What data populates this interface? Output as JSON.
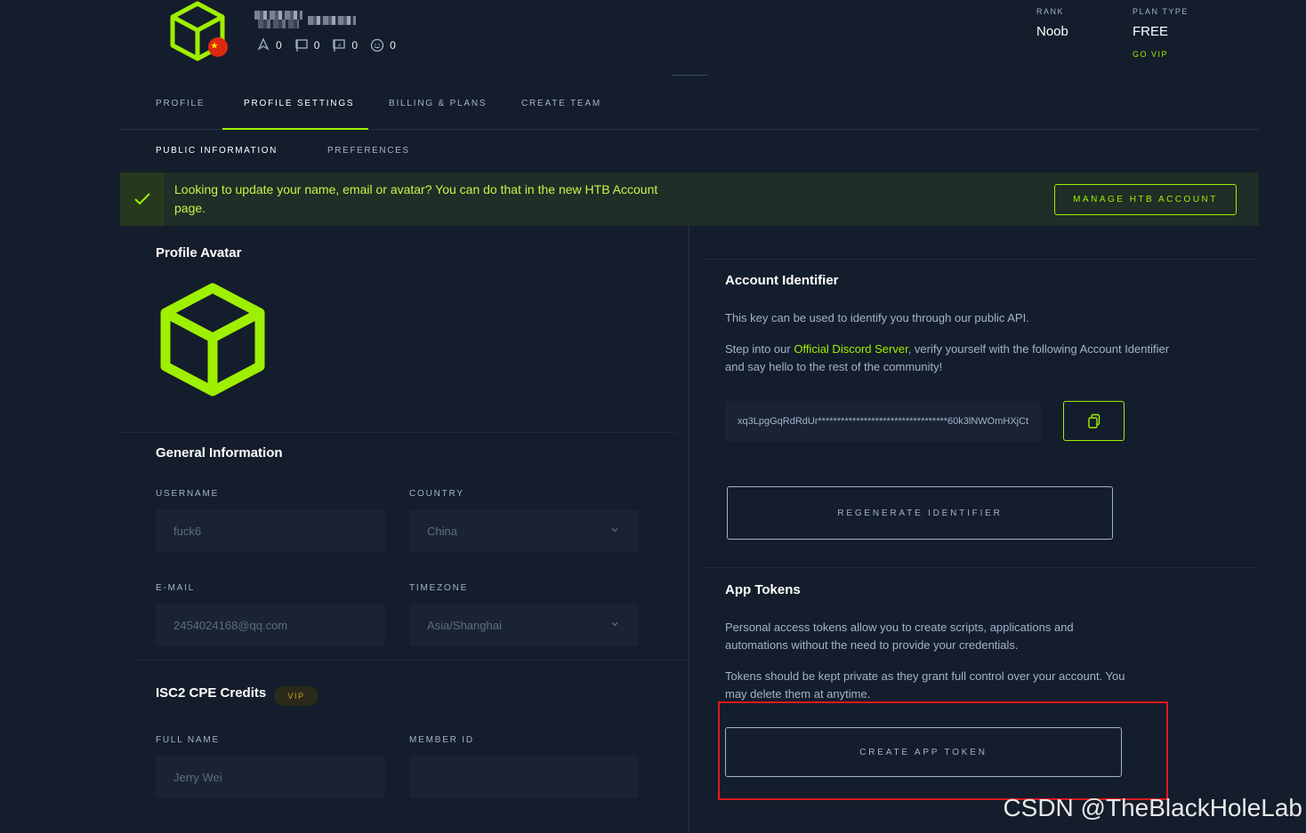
{
  "header": {
    "rank_label": "RANK",
    "rank_value": "Noob",
    "plan_label": "PLAN TYPE",
    "plan_value": "FREE",
    "go_vip": "GO VIP",
    "stats": [
      {
        "icon": "target-icon",
        "value": "0"
      },
      {
        "icon": "user-flag-icon",
        "value": "0"
      },
      {
        "icon": "root-flag-icon",
        "value": "0"
      },
      {
        "icon": "smile-icon",
        "value": "0"
      }
    ],
    "country_flag_icon": "china-flag-icon"
  },
  "tabs": [
    {
      "label": "PROFILE"
    },
    {
      "label": "PROFILE SETTINGS"
    },
    {
      "label": "BILLING & PLANS"
    },
    {
      "label": "CREATE TEAM"
    }
  ],
  "subtabs": [
    {
      "label": "PUBLIC INFORMATION"
    },
    {
      "label": "PREFERENCES"
    }
  ],
  "banner": {
    "text": "Looking to update your name, email or avatar? You can do that in the new HTB Account page.",
    "button": "MANAGE HTB ACCOUNT"
  },
  "avatar": {
    "title": "Profile Avatar"
  },
  "general": {
    "title": "General Information",
    "username_label": "USERNAME",
    "username_value": "fuck6",
    "country_label": "COUNTRY",
    "country_value": "China",
    "email_label": "E-MAIL",
    "email_value": "2454024168@qq.com",
    "timezone_label": "TIMEZONE",
    "timezone_value": "Asia/Shanghai"
  },
  "cpe": {
    "title": "ISC2 CPE Credits",
    "badge": "VIP",
    "fullname_label": "FULL NAME",
    "fullname_value": "Jerry Wei",
    "member_label": "MEMBER ID",
    "member_value": ""
  },
  "identifier": {
    "title": "Account Identifier",
    "desc1": "This key can be used to identify you through our public API.",
    "desc2_pre": "Step into our ",
    "desc2_link": "Official Discord Server",
    "desc2_post": ", verify yourself with the following Account Identifier and say hello to the rest of the community!",
    "value": "xq3LpgGqRdRdUr**********************************60k3lNWOmHXjCt",
    "regenerate": "REGENERATE IDENTIFIER"
  },
  "tokens": {
    "title": "App Tokens",
    "desc1": "Personal access tokens allow you to create scripts, applications and automations without the need to provide your credentials.",
    "desc2": "Tokens should be kept private as they grant full control over your account. You may delete them at anytime.",
    "create": "CREATE APP TOKEN"
  },
  "watermark": "CSDN @TheBlackHoleLab",
  "colors": {
    "background": "#141d2b",
    "accent": "#9fef00",
    "text": "#a4b1cd",
    "highlight": "#e0191f"
  }
}
